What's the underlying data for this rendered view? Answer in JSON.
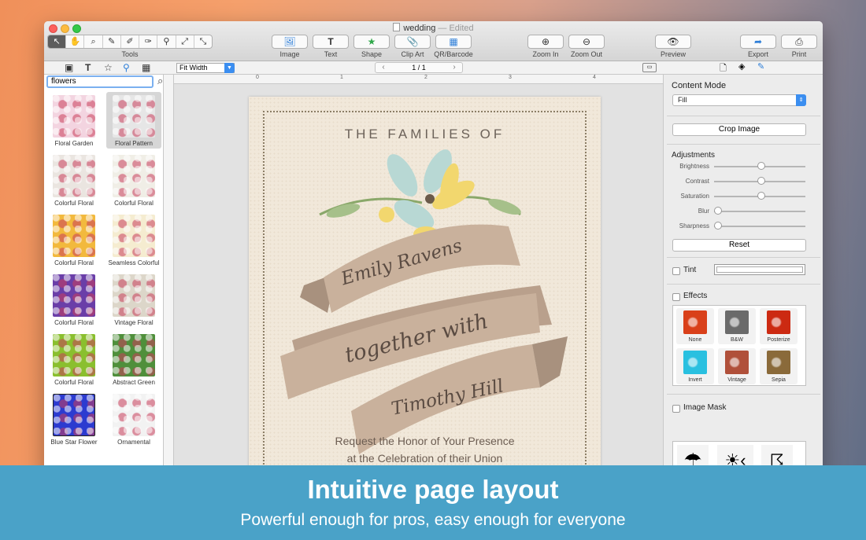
{
  "window": {
    "title": "wedding",
    "status": "— Edited"
  },
  "toolbar": {
    "tools_label": "Tools",
    "tool_glyphs": [
      "↖",
      "✋",
      "⌕",
      "✎",
      "✐",
      "✑",
      "⚲",
      "⤢",
      "⤡"
    ],
    "buttons": [
      {
        "label": "Image",
        "glyph": "🖼"
      },
      {
        "label": "Text",
        "glyph": "T"
      },
      {
        "label": "Shape",
        "glyph": "★"
      },
      {
        "label": "Clip Art",
        "glyph": "📎"
      },
      {
        "label": "QR/Barcode",
        "glyph": "▦"
      },
      {
        "label": "Zoom In",
        "glyph": "⊕"
      },
      {
        "label": "Zoom Out",
        "glyph": "⊖"
      },
      {
        "label": "Preview",
        "glyph": "👁"
      },
      {
        "label": "Export",
        "glyph": "➦"
      },
      {
        "label": "Print",
        "glyph": "⎙"
      }
    ]
  },
  "subbar": {
    "zoom": "Fit Width",
    "page": "1 / 1",
    "prev": "‹",
    "next": "›"
  },
  "sidebar": {
    "search_value": "flowers",
    "items": [
      {
        "label": "Floral Garden",
        "color": "#f3d4e0",
        "selected": false
      },
      {
        "label": "Floral Pattern",
        "color": "#e6e6e6",
        "selected": true
      },
      {
        "label": "Colorful Floral",
        "color": "#eae5e0",
        "selected": false
      },
      {
        "label": "Colorful Floral",
        "color": "#f0eee6",
        "selected": false
      },
      {
        "label": "Colorful Floral",
        "color": "#f2b93d",
        "selected": false
      },
      {
        "label": "Seamless Colorful",
        "color": "#f5ecd0",
        "selected": false
      },
      {
        "label": "Colorful Floral",
        "color": "#6a3ea8",
        "selected": false
      },
      {
        "label": "Vintage Floral",
        "color": "#dcd6c9",
        "selected": false
      },
      {
        "label": "Colorful Floral",
        "color": "#8abf2e",
        "selected": false
      },
      {
        "label": "Abstract Green",
        "color": "#4f8f3b",
        "selected": false
      },
      {
        "label": "Blue Star Flower",
        "color": "#2c3bd0",
        "selected": false
      },
      {
        "label": "Ornamental",
        "color": "#f2f2f2",
        "selected": false
      }
    ]
  },
  "card": {
    "heading": "THE FAMILIES OF",
    "name1": "Emily Ravens",
    "middle": "together with",
    "name2": "Timothy Hill",
    "line1": "Request the Honor of Your Presence",
    "line2": "at the Celebration of their Union"
  },
  "inspector": {
    "tab_glyphs": [
      "🗋",
      "◈",
      "✎"
    ],
    "content_mode_label": "Content Mode",
    "content_mode_value": "Fill",
    "crop_label": "Crop Image",
    "adjustments_label": "Adjustments",
    "sliders": [
      {
        "label": "Brightness",
        "value": 0.5
      },
      {
        "label": "Contrast",
        "value": 0.5
      },
      {
        "label": "Saturation",
        "value": 0.5
      },
      {
        "label": "Blur",
        "value": 0
      },
      {
        "label": "Sharpness",
        "value": 0
      }
    ],
    "reset_label": "Reset",
    "tint_label": "Tint",
    "effects_label": "Effects",
    "effects": [
      {
        "label": "None",
        "color": "#d9401a"
      },
      {
        "label": "B&W",
        "color": "#6a6a6a"
      },
      {
        "label": "Posterize",
        "color": "#cc2a12"
      },
      {
        "label": "Invert",
        "color": "#29c0e0"
      },
      {
        "label": "Vintage",
        "color": "#b0503a"
      },
      {
        "label": "Sepia",
        "color": "#8a6a3a"
      }
    ],
    "image_mask_label": "Image Mask",
    "mask_glyphs": [
      "☂",
      "☀‹",
      "☈"
    ]
  },
  "banner": {
    "title": "Intuitive page layout",
    "subtitle": "Powerful enough for pros, easy enough for everyone"
  }
}
